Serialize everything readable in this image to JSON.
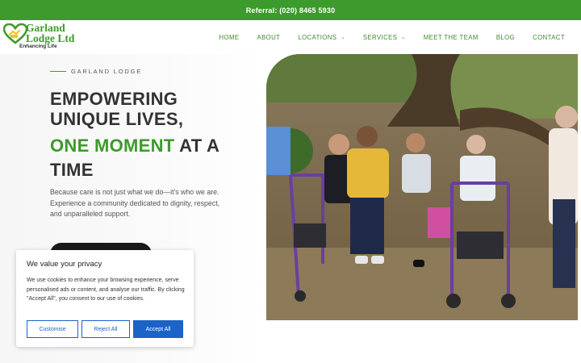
{
  "topbar": {
    "referral_text": "Referral: (020) 8465 5930"
  },
  "logo": {
    "title_line1": "Garland",
    "title_line2": "Lodge Ltd",
    "tagline": "Enhancing Life"
  },
  "nav": {
    "items": [
      {
        "label": "HOME",
        "has_dropdown": false
      },
      {
        "label": "ABOUT",
        "has_dropdown": false
      },
      {
        "label": "LOCATIONS",
        "has_dropdown": true
      },
      {
        "label": "SERVICES",
        "has_dropdown": true
      },
      {
        "label": "MEET THE TEAM",
        "has_dropdown": false
      },
      {
        "label": "BLOG",
        "has_dropdown": false
      },
      {
        "label": "CONTACT",
        "has_dropdown": false
      }
    ]
  },
  "hero": {
    "eyebrow": "GARLAND LODGE",
    "line1": "EMPOWERING",
    "line2": "UNIQUE LIVES,",
    "highlight": "ONE MOMENT",
    "line3_rest": " AT A",
    "line4": "TIME",
    "body": "Because care is not just what we do—it's who we are. Experience a community dedicated to dignity, respect, and unparalleled support."
  },
  "cookie": {
    "title": "We value your privacy",
    "body": "We use cookies to enhance your browsing experience, serve personalised ads or content, and analyse our traffic. By clicking \"Accept All\", you consent to our use of cookies.",
    "customise": "Customise",
    "reject": "Reject All",
    "accept": "Accept All"
  },
  "colors": {
    "brand_green": "#3d9a2c",
    "cookie_blue": "#1a63c8"
  }
}
